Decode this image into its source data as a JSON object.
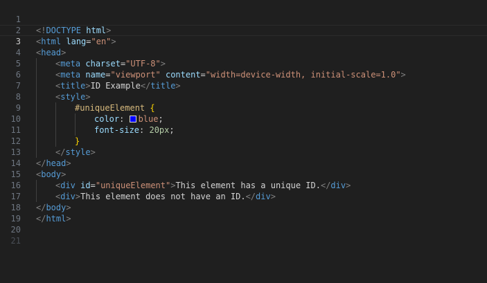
{
  "editor": {
    "line_numbers": [
      "1",
      "2",
      "3",
      "4",
      "5",
      "6",
      "7",
      "8",
      "9",
      "10",
      "11",
      "12",
      "13",
      "14",
      "15",
      "16",
      "17",
      "18",
      "19",
      "20",
      "21"
    ],
    "colors": {
      "swatch_blue": "#0000ff"
    },
    "code": {
      "l3_a": "<!",
      "l3_b": "DOCTYPE",
      "l3_c": " html",
      "l3_d": ">",
      "l4_a": "<",
      "l4_b": "html",
      "l4_c": " lang",
      "l4_d": "=",
      "l4_e": "\"en\"",
      "l4_f": ">",
      "l5_a": "<",
      "l5_b": "head",
      "l5_c": ">",
      "l6_a": "<",
      "l6_b": "meta",
      "l6_c": " charset",
      "l6_d": "=",
      "l6_e": "\"UTF-8\"",
      "l6_f": ">",
      "l7_a": "<",
      "l7_b": "meta",
      "l7_c": " name",
      "l7_d": "=",
      "l7_e": "\"viewport\"",
      "l7_f": " content",
      "l7_g": "=",
      "l7_h": "\"width=device-width, initial-scale=1.0\"",
      "l7_i": ">",
      "l8_a": "<",
      "l8_b": "title",
      "l8_c": ">",
      "l8_d": "ID Example",
      "l8_e": "</",
      "l8_f": "title",
      "l8_g": ">",
      "l9_a": "<",
      "l9_b": "style",
      "l9_c": ">",
      "l10_a": "#uniqueElement",
      "l10_b": " {",
      "l11_a": "color",
      "l11_b": ": ",
      "l11_c": "blue",
      "l11_d": ";",
      "l12_a": "font-size",
      "l12_b": ": ",
      "l12_c": "20px",
      "l12_d": ";",
      "l13_a": "}",
      "l14_a": "</",
      "l14_b": "style",
      "l14_c": ">",
      "l15_a": "</",
      "l15_b": "head",
      "l15_c": ">",
      "l16_a": "<",
      "l16_b": "body",
      "l16_c": ">",
      "l17_a": "<",
      "l17_b": "div",
      "l17_c": " id",
      "l17_d": "=",
      "l17_e": "\"uniqueElement\"",
      "l17_f": ">",
      "l17_g": "This element has a unique ID.",
      "l17_h": "</",
      "l17_i": "div",
      "l17_j": ">",
      "l18_a": "<",
      "l18_b": "div",
      "l18_c": ">",
      "l18_d": "This element does not have an ID.",
      "l18_e": "</",
      "l18_f": "div",
      "l18_g": ">",
      "l19_a": "</",
      "l19_b": "body",
      "l19_c": ">",
      "l20_a": "</",
      "l20_b": "html",
      "l20_c": ">"
    }
  }
}
